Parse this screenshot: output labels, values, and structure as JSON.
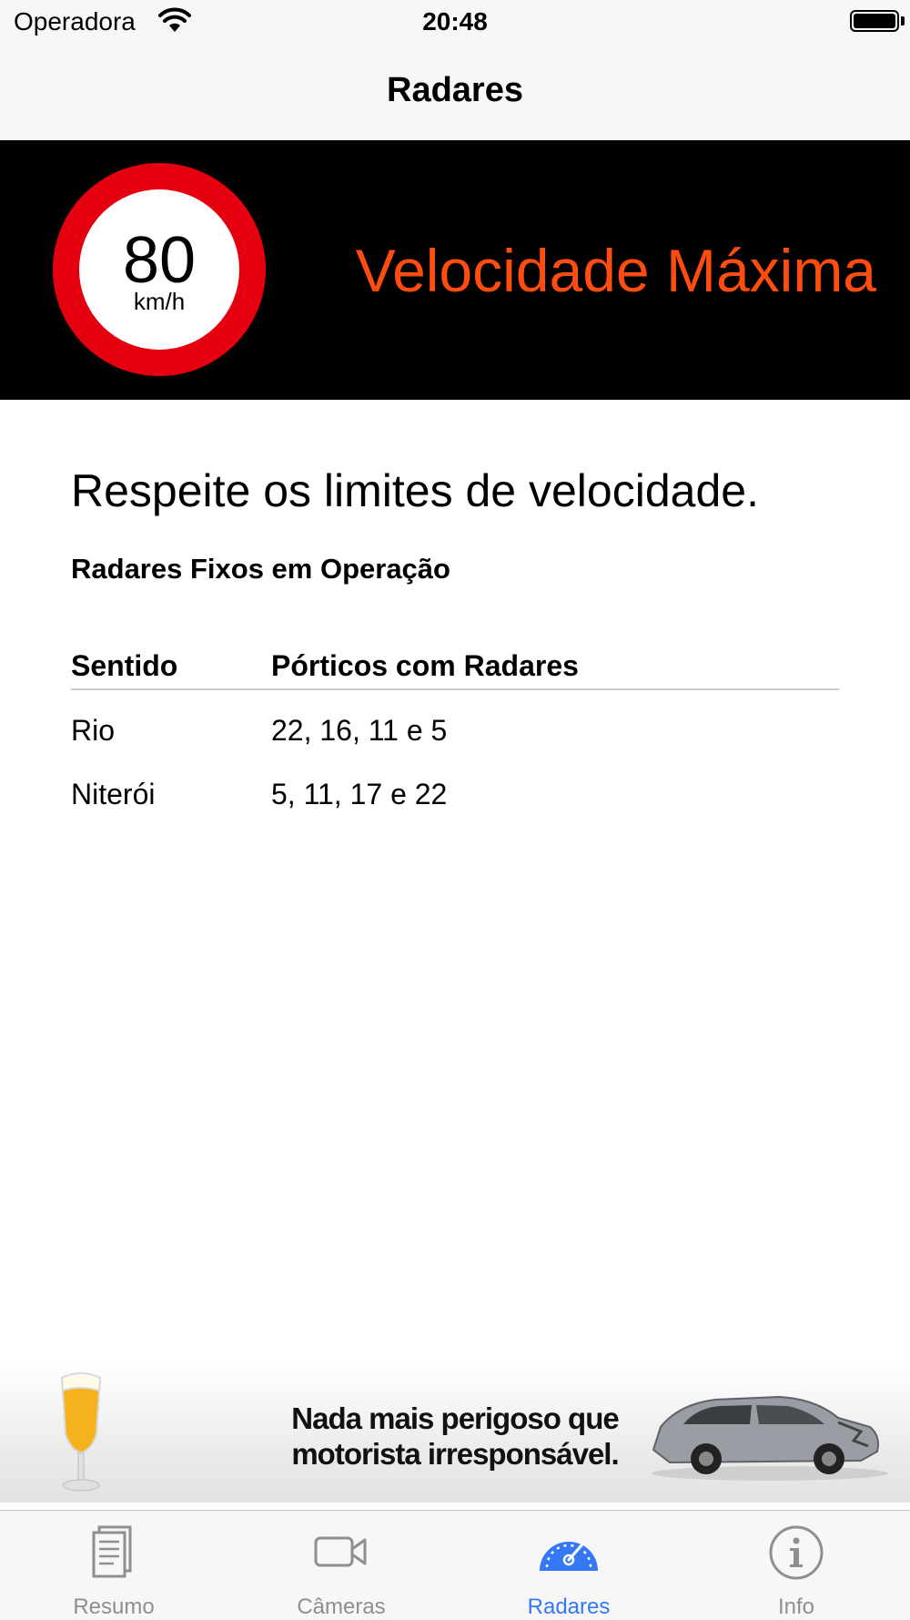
{
  "status_bar": {
    "carrier": "Operadora",
    "time": "20:48"
  },
  "nav": {
    "title": "Radares"
  },
  "banner": {
    "speed_value": "80",
    "speed_unit": "km/h",
    "title": "Velocidade Máxima"
  },
  "content": {
    "heading": "Respeite os limites de velocidade.",
    "subheading": "Radares Fixos em Operação",
    "table": {
      "headers": [
        "Sentido",
        "Pórticos com Radares"
      ],
      "rows": [
        [
          "Rio",
          "22, 16, 11 e 5"
        ],
        [
          "Niterói",
          "5, 11, 17 e 22"
        ]
      ]
    }
  },
  "ad": {
    "line1": "Nada mais perigoso que",
    "line2": "motorista irresponsável."
  },
  "tabs": [
    {
      "label": "Resumo",
      "icon": "document-icon",
      "active": false
    },
    {
      "label": "Câmeras",
      "icon": "video-camera-icon",
      "active": false
    },
    {
      "label": "Radares",
      "icon": "speedometer-icon",
      "active": true
    },
    {
      "label": "Info",
      "icon": "info-icon",
      "active": false
    }
  ],
  "colors": {
    "banner_title": "#ff4c0f",
    "sign_red": "#e4000f",
    "tab_active": "#3478f6",
    "tab_inactive": "#8e8e93"
  }
}
